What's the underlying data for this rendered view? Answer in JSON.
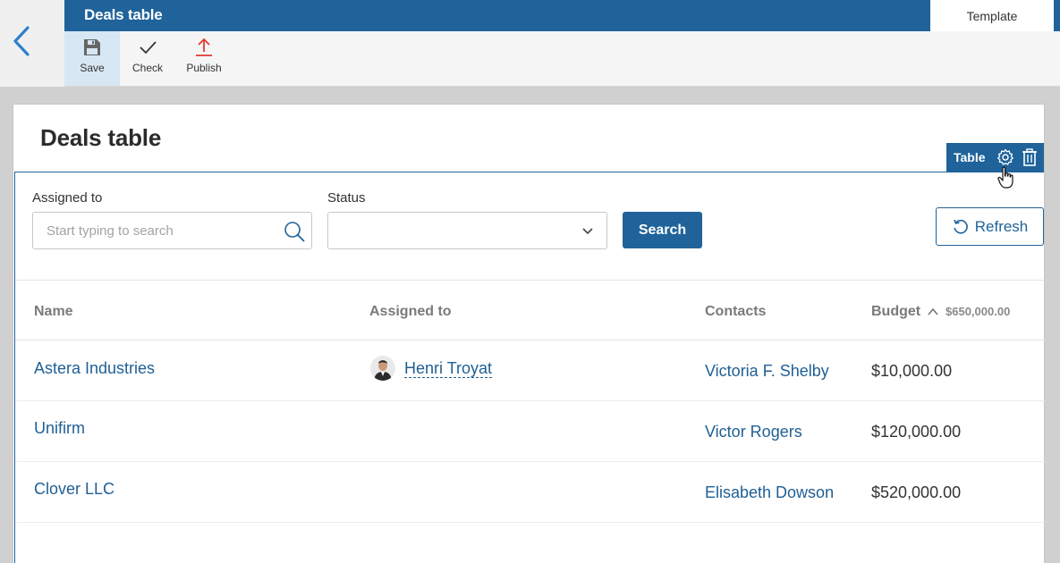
{
  "header": {
    "title": "Deals table",
    "template_tab": "Template"
  },
  "toolbar": {
    "save_label": "Save",
    "check_label": "Check",
    "publish_label": "Publish"
  },
  "page": {
    "title": "Deals table",
    "widget_label": "Table"
  },
  "filters": {
    "assigned_label": "Assigned to",
    "assigned_placeholder": "Start typing to search",
    "status_label": "Status",
    "status_value": "",
    "search_button": "Search",
    "refresh_button": "Refresh"
  },
  "table": {
    "columns": [
      "Name",
      "Assigned to",
      "Contacts",
      "Budget"
    ],
    "budget_total": "$650,000.00",
    "rows": [
      {
        "name": "Astera Industries",
        "assigned": "Henri Troyat",
        "contact": "Victoria F. Shelby",
        "budget": "$10,000.00"
      },
      {
        "name": "Unifirm",
        "assigned": "",
        "contact": "Victor Rogers",
        "budget": "$120,000.00"
      },
      {
        "name": "Clover LLC",
        "assigned": "",
        "contact": "Elisabeth Dowson",
        "budget": "$520,000.00"
      }
    ]
  },
  "colors": {
    "brand": "#1f639a",
    "link": "#1f5f94",
    "publish_icon": "#e53935",
    "canvas": "#d0d0d0"
  },
  "icons": [
    "back-arrow-icon",
    "save-icon",
    "check-icon",
    "publish-icon",
    "gear-icon",
    "trash-icon",
    "search-icon",
    "chevron-down-icon",
    "refresh-icon",
    "sort-asc-icon",
    "hand-cursor-icon"
  ]
}
